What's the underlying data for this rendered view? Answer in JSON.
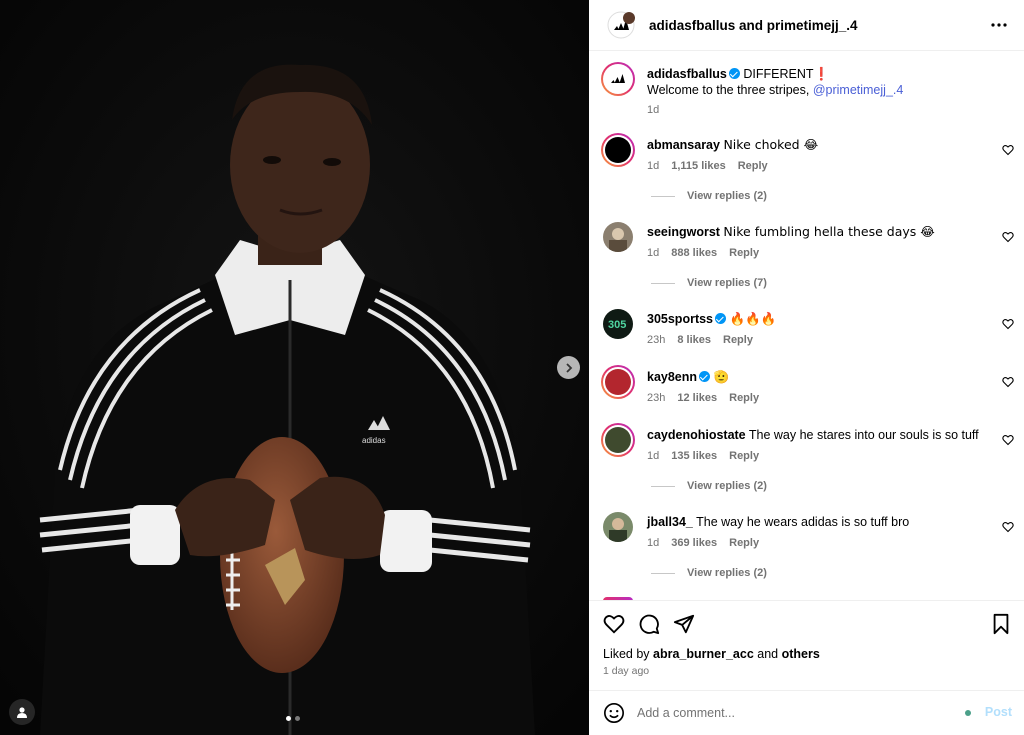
{
  "header": {
    "title": "adidasfballus and primetimejj_.4",
    "more_icon": "more-horizontal-icon"
  },
  "caption": {
    "username": "adidasfballus",
    "first_line": "DIFFERENT",
    "first_line_emoji": "❗",
    "second_line": "Welcome to the three stripes, ",
    "mention": "@primetimejj_.4",
    "time": "1d"
  },
  "comments": [
    {
      "username": "abmansaray",
      "verified": false,
      "text": "Nike choked 😂",
      "time": "1d",
      "likes": "1,115 likes",
      "reply": "Reply",
      "view_replies": "View replies (2)"
    },
    {
      "username": "seeingworst",
      "verified": false,
      "text": "Nike fumbling hella these days 😂",
      "time": "1d",
      "likes": "888 likes",
      "reply": "Reply",
      "view_replies": "View replies (7)"
    },
    {
      "username": "305sportss",
      "verified": true,
      "text": "🔥🔥🔥",
      "time": "23h",
      "likes": "8 likes",
      "reply": "Reply"
    },
    {
      "username": "kay8enn",
      "verified": true,
      "text": "🫡",
      "time": "23h",
      "likes": "12 likes",
      "reply": "Reply"
    },
    {
      "username": "caydenohiostate",
      "verified": false,
      "text": "The way he stares into our souls is so tuff",
      "time": "1d",
      "likes": "135 likes",
      "reply": "Reply",
      "view_replies": "View replies (2)"
    },
    {
      "username": "jball34_",
      "verified": false,
      "text": "The way he wears adidas is so tuff bro",
      "time": "1d",
      "likes": "369 likes",
      "reply": "Reply",
      "view_replies": "View replies (2)"
    }
  ],
  "actions": {
    "icons": [
      "heart-icon",
      "comment-icon",
      "share-icon",
      "bookmark-icon"
    ],
    "liked_by_prefix": "Liked by ",
    "liked_by_user": "abra_burner_acc",
    "liked_by_and": " and ",
    "liked_by_others": "others",
    "time_ago": "1 day ago"
  },
  "add_comment": {
    "placeholder": "Add a comment...",
    "post_label": "Post"
  },
  "media": {
    "carousel_position": 1,
    "carousel_count": 2
  },
  "colors": {
    "verified": "#0095f6",
    "mention": "#4a5fd6",
    "post_disabled": "#b2dffc",
    "muted": "#737373"
  }
}
